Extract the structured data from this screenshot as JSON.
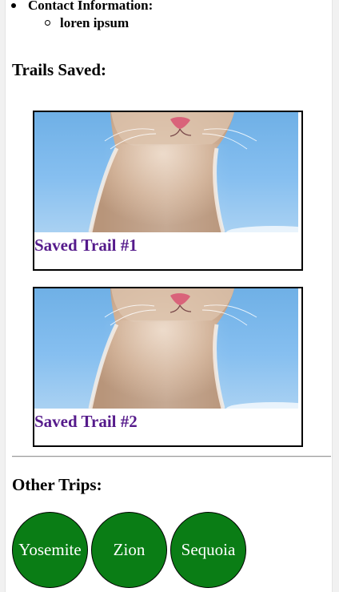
{
  "profile": {
    "contact_label": "Contact Information:",
    "contact_value": "loren ipsum"
  },
  "saved_section": {
    "title": "Trails Saved:",
    "trails": [
      {
        "label": "Saved Trail #1",
        "image": "kitten-photo"
      },
      {
        "label": "Saved Trail #2",
        "image": "kitten-photo"
      }
    ]
  },
  "other_section": {
    "title": "Other Trips:",
    "trips": [
      {
        "label": "Yosemite"
      },
      {
        "label": "Zion"
      },
      {
        "label": "Sequoia"
      }
    ]
  },
  "colors": {
    "link": "#551a8b",
    "trip_button": "#0a7d15",
    "sky": "#86bff0"
  }
}
